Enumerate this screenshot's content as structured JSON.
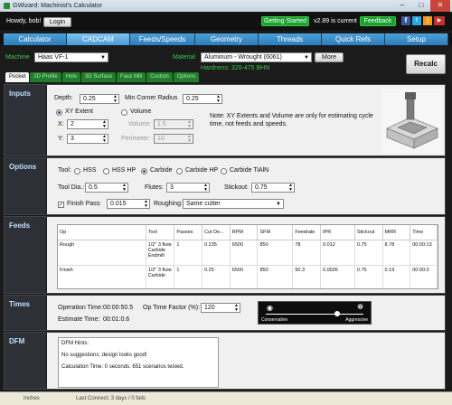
{
  "window": {
    "title": "GWizard: Machinist's Calculator"
  },
  "header": {
    "greeting": "Howdy, bob!",
    "login": "Login",
    "getting_started": "Getting Started",
    "version": "v2.89 is current",
    "feedback": "Feedback"
  },
  "tabs": [
    "Calculator",
    "CADCAM",
    "Feeds/Speeds",
    "Geometry",
    "Threads",
    "Quick Refs",
    "Setup"
  ],
  "machine": {
    "label": "Machine",
    "value": "Haas VF-1",
    "material_label": "Material",
    "material_value": "Aluminum - Wrought (6061)",
    "more": "More",
    "hardness": "Hardness: 320-475 BHN",
    "recalc": "Recalc"
  },
  "subtabs": [
    "Pocket",
    "2D Profile",
    "Hole",
    "3D Surface",
    "Face Mill",
    "Custom",
    "Options"
  ],
  "inputs": {
    "title": "Inputs",
    "depth_label": "Depth:",
    "depth": "0.25",
    "corner_label": "Min Corner Radius",
    "corner": "0.25",
    "xy_label": "XY Extent",
    "volume_label": "Volume",
    "x_label": "X:",
    "x": "2",
    "volume_field_label": "Volume:",
    "volume_value": "1.5",
    "y_label": "Y:",
    "y": "3",
    "perimeter_label": "Perimeter:",
    "perimeter": "10",
    "note": "Note: XY Extents and Volume are only for estimating cycle time, not feeds and speeds."
  },
  "options": {
    "title": "Options",
    "tool_label": "Tool:",
    "tools": [
      "HSS",
      "HSS HP",
      "Carbide",
      "Carbide HP",
      "Carbide TiAlN"
    ],
    "tool_dia_label": "Tool Dia.:",
    "tool_dia": "0.5",
    "flutes_label": "Flutes:",
    "flutes": "3",
    "stickout_label": "Stickout:",
    "stickout": "0.75",
    "finish_label": "Finish Pass:",
    "finish": "0.015",
    "roughing_label": "Roughing:",
    "roughing": "Same cutter"
  },
  "feeds": {
    "title": "Feeds",
    "columns": [
      "Op",
      "Tool",
      "Passes",
      "Cut De...",
      "RPM",
      "SFM",
      "Feedrate",
      "IPR",
      "Stickout",
      "MRR",
      "Time"
    ],
    "rows": [
      [
        "Rough",
        "1/2\" 3 flute Carbide Endmill",
        "1",
        "0.235",
        "6500",
        "850",
        "78",
        "0.012",
        "0.75",
        "8.78",
        "00:00:13"
      ],
      [
        "Finish",
        "1/2\" 3 flute Carbide",
        "1",
        "0.25",
        "6500",
        "850",
        "50.3",
        "0.0026",
        "0.75",
        "0.19",
        "00:00:3"
      ]
    ]
  },
  "times": {
    "title": "Times",
    "op_time_label": "Operation Time:",
    "op_time": "00:00:50.5",
    "factor_label": "Op Time Factor (%):",
    "factor": "120",
    "estimate_label": "Estimate Time:",
    "estimate": "00:01:0.6",
    "conservative": "Conservative",
    "aggressive": "Aggressive"
  },
  "dfm": {
    "title": "DFM",
    "hints_title": "DFM Hints:",
    "hint1": "No suggestions: design looks good!",
    "hint2": "Calculation Time: 0 seconds. 651 scenarios tested."
  },
  "status": {
    "units": "Inches",
    "last_connect": "Last Connect: 3 days / 0 fails"
  }
}
